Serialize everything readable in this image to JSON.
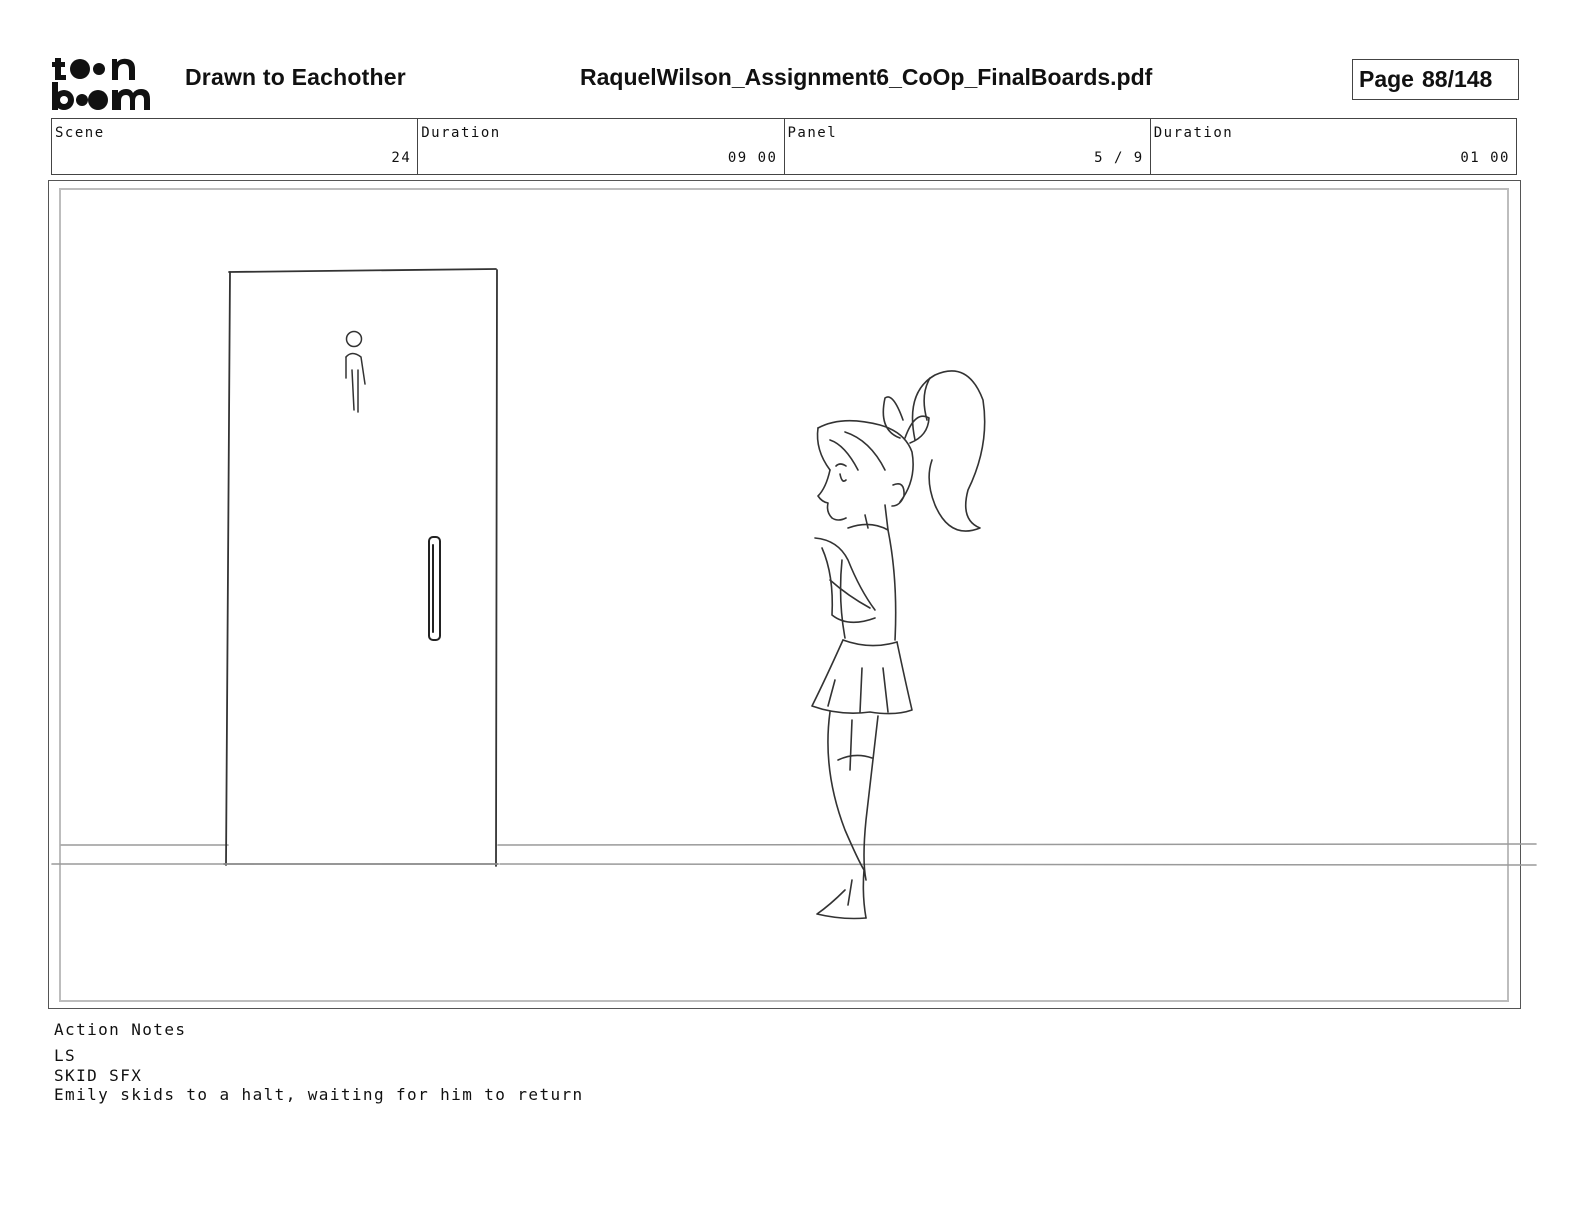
{
  "header": {
    "logo": "toon boom",
    "project_title": "Drawn to Eachother",
    "file_name": "RaquelWilson_Assignment6_CoOp_FinalBoards.pdf",
    "page_label": "Page",
    "page_value": "88/148"
  },
  "info": {
    "scene_label": "Scene",
    "scene_value": "24",
    "scene_duration_label": "Duration",
    "scene_duration_value": "09 00",
    "panel_label": "Panel",
    "panel_value": "5 / 9",
    "panel_duration_label": "Duration",
    "panel_duration_value": "01 00"
  },
  "panel": {
    "icons": [
      "restroom-door",
      "restroom-sign-icon",
      "door-handle",
      "girl-character-sketch"
    ]
  },
  "notes": {
    "label": "Action Notes",
    "lines": [
      "LS",
      "SKID SFX",
      "Emily skids to a halt, waiting for him to return"
    ]
  }
}
